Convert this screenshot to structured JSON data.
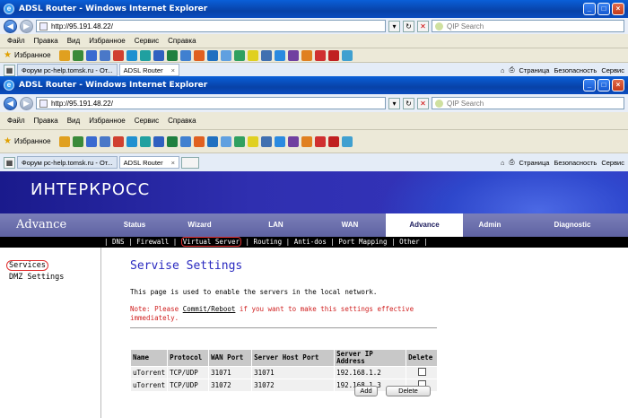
{
  "browser": {
    "title": "ADSL Router - Windows Internet Explorer",
    "address": "http://95.191.48.22/",
    "search_placeholder": "QIP Search",
    "menu": [
      "Файл",
      "Правка",
      "Вид",
      "Избранное",
      "Сервис",
      "Справка"
    ],
    "favorites_label": "Избранное",
    "tabs": [
      {
        "label": "Форум pc-help.tomsk.ru - От..."
      },
      {
        "label": "ADSL Router"
      }
    ],
    "cmd": {
      "page": "Страница",
      "security": "Безопасность",
      "service": "Сервис"
    }
  },
  "router": {
    "logo": "ИНТЕРКРОСС",
    "section": "Advance",
    "nav": [
      "Status",
      "Wizard",
      "LAN",
      "WAN",
      "Advance",
      "Admin",
      "Diagnostic"
    ],
    "subnav": "| DNS | Firewall | Virtual Server | Routing | Anti-dos | Port Mapping | Other |",
    "subnav_parts": {
      "pre": "| DNS | Firewall | ",
      "hl": "Virtual Server",
      "post": " | Routing | Anti-dos | Port Mapping | Other |"
    },
    "left_menu": [
      "Services",
      "DMZ Settings"
    ],
    "page_title": "Servise Settings",
    "description": "This page is used to enable the servers in the local network.",
    "note_pre": "Note: Please ",
    "note_link": "Commit/Reboot",
    "note_post": " if you want to make this settings effective immediately.",
    "table": {
      "headers": [
        "Name",
        "Protocol",
        "WAN Port",
        "Server Host Port",
        "Server IP Address",
        "Delete"
      ],
      "rows": [
        {
          "name": "uTorrent",
          "protocol": "TCP/UDP",
          "wan_port": "31071",
          "host_port": "31071",
          "ip": "192.168.1.2"
        },
        {
          "name": "uTorrent",
          "protocol": "TCP/UDP",
          "wan_port": "31072",
          "host_port": "31072",
          "ip": "192.168.1.3"
        }
      ]
    },
    "buttons": {
      "add": "Add",
      "delete": "Delete"
    }
  }
}
